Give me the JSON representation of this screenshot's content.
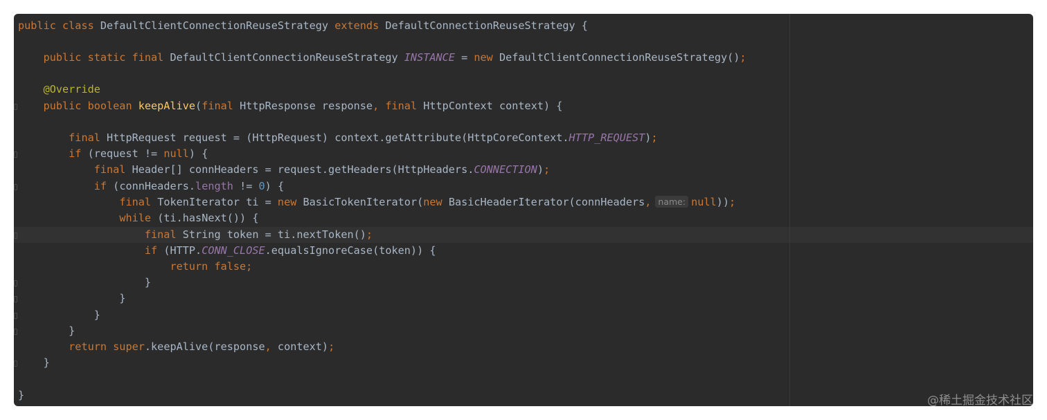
{
  "editor": {
    "lines": [
      {
        "tokens": [
          [
            "kw",
            "public class "
          ],
          [
            "cls",
            "DefaultClientConnectionReuseStrategy "
          ],
          [
            "kw",
            "extends "
          ],
          [
            "cls",
            "DefaultConnectionReuseStrategy {"
          ]
        ]
      },
      {
        "tokens": []
      },
      {
        "tokens": [
          [
            "cls",
            "    "
          ],
          [
            "kw",
            "public static final "
          ],
          [
            "cls",
            "DefaultClientConnectionReuseStrategy "
          ],
          [
            "const",
            "INSTANCE"
          ],
          [
            "cls",
            " = "
          ],
          [
            "kw",
            "new "
          ],
          [
            "cls",
            "DefaultClientConnectionReuseStrategy()"
          ],
          [
            "kw",
            ";"
          ]
        ]
      },
      {
        "tokens": []
      },
      {
        "tokens": [
          [
            "cls",
            "    "
          ],
          [
            "ann",
            "@Override"
          ]
        ]
      },
      {
        "tokens": [
          [
            "cls",
            "    "
          ],
          [
            "kw",
            "public boolean "
          ],
          [
            "fn",
            "keepAlive"
          ],
          [
            "cls",
            "("
          ],
          [
            "kw",
            "final "
          ],
          [
            "cls",
            "HttpResponse response"
          ],
          [
            "kw",
            ", final "
          ],
          [
            "cls",
            "HttpContext context) {"
          ]
        ]
      },
      {
        "tokens": []
      },
      {
        "tokens": [
          [
            "cls",
            "        "
          ],
          [
            "kw",
            "final "
          ],
          [
            "cls",
            "HttpRequest request = (HttpRequest) context.getAttribute(HttpCoreContext."
          ],
          [
            "const",
            "HTTP_REQUEST"
          ],
          [
            "cls",
            ")"
          ],
          [
            "kw",
            ";"
          ]
        ]
      },
      {
        "tokens": [
          [
            "cls",
            "        "
          ],
          [
            "kw",
            "if "
          ],
          [
            "cls",
            "(request != "
          ],
          [
            "kw",
            "null"
          ],
          [
            "cls",
            ") {"
          ]
        ]
      },
      {
        "tokens": [
          [
            "cls",
            "            "
          ],
          [
            "kw",
            "final "
          ],
          [
            "cls",
            "Header[] connHeaders = request.getHeaders(HttpHeaders."
          ],
          [
            "const",
            "CONNECTION"
          ],
          [
            "cls",
            ")"
          ],
          [
            "kw",
            ";"
          ]
        ]
      },
      {
        "tokens": [
          [
            "cls",
            "            "
          ],
          [
            "kw",
            "if "
          ],
          [
            "cls",
            "(connHeaders."
          ],
          [
            "field",
            "length"
          ],
          [
            "cls",
            " != "
          ],
          [
            "num",
            "0"
          ],
          [
            "cls",
            ") {"
          ]
        ]
      },
      {
        "tokens": [
          [
            "cls",
            "                "
          ],
          [
            "kw",
            "final "
          ],
          [
            "cls",
            "TokenIterator ti = "
          ],
          [
            "kw",
            "new "
          ],
          [
            "cls",
            "BasicTokenIterator("
          ],
          [
            "kw",
            "new "
          ],
          [
            "cls",
            "BasicHeaderIterator(connHeaders"
          ],
          [
            "kw",
            ","
          ],
          [
            "hint",
            "name:"
          ],
          [
            "kw",
            "null"
          ],
          [
            "cls",
            "))"
          ],
          [
            "kw",
            ";"
          ]
        ]
      },
      {
        "tokens": [
          [
            "cls",
            "                "
          ],
          [
            "kw",
            "while "
          ],
          [
            "cls",
            "(ti.hasNext()) {"
          ]
        ]
      },
      {
        "tokens": [
          [
            "cls",
            "                    "
          ],
          [
            "kw",
            "final "
          ],
          [
            "cls",
            "String token = ti.nextToken()"
          ],
          [
            "kw",
            ";"
          ]
        ]
      },
      {
        "tokens": [
          [
            "cls",
            "                    "
          ],
          [
            "kw",
            "if "
          ],
          [
            "cls",
            "(HTTP."
          ],
          [
            "const",
            "CONN_CLOSE"
          ],
          [
            "cls",
            ".equalsIgnoreCase(token)) {"
          ]
        ]
      },
      {
        "tokens": [
          [
            "cls",
            "                        "
          ],
          [
            "kw",
            "return false;"
          ]
        ]
      },
      {
        "tokens": [
          [
            "cls",
            "                    }"
          ]
        ]
      },
      {
        "tokens": [
          [
            "cls",
            "                }"
          ]
        ]
      },
      {
        "tokens": [
          [
            "cls",
            "            }"
          ]
        ]
      },
      {
        "tokens": [
          [
            "cls",
            "        }"
          ]
        ]
      },
      {
        "tokens": [
          [
            "cls",
            "        "
          ],
          [
            "kw",
            "return super"
          ],
          [
            "cls",
            ".keepAlive(response"
          ],
          [
            "kw",
            ", "
          ],
          [
            "cls",
            "context)"
          ],
          [
            "kw",
            ";"
          ]
        ]
      },
      {
        "tokens": [
          [
            "cls",
            "    }"
          ]
        ]
      },
      {
        "tokens": []
      },
      {
        "tokens": [
          [
            "cls",
            "}"
          ]
        ]
      }
    ]
  },
  "watermark": "@稀土掘金技术社区",
  "colors": {
    "background": "#2b2b2b",
    "keyword": "#cc7832",
    "identifier": "#a9b7c6",
    "method": "#ffc66d",
    "annotation": "#bbb529",
    "constant": "#9876aa",
    "number": "#6897bb"
  }
}
